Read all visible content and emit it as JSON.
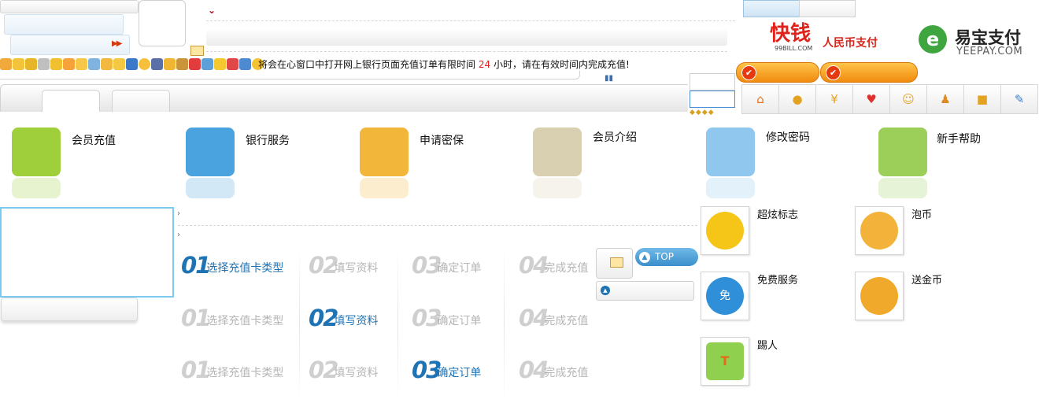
{
  "header": {
    "notice_prefix": "将会在心窗口中打开网上银行页面充值订单有限时间",
    "notice_hours": "24",
    "notice_suffix": "小时，请在有效时间内完成充值!",
    "rmb_pay": "人民币支付",
    "logo_99_big": "快钱",
    "logo_99_small": "99BILL.COM",
    "yeepay_title": "易宝支付",
    "yeepay_sub": "YEEPAY.COM",
    "yeepay_mark": "e"
  },
  "services": [
    {
      "label": "会员充值",
      "icon": "money-bags-icon",
      "color": "#9fcf3a"
    },
    {
      "label": "银行服务",
      "icon": "bank-card-icon",
      "color": "#4aa3df"
    },
    {
      "label": "申请密保",
      "icon": "safe-icon",
      "color": "#f2b63a"
    },
    {
      "label": "会员介绍",
      "icon": "coins-icon",
      "color": "#c9c9c9"
    },
    {
      "label": "修改密码",
      "icon": "padlock-icon",
      "color": "#8fc7ef"
    },
    {
      "label": "新手帮助",
      "icon": "help-lifebuoy-icon",
      "color": "#9ccf5a"
    }
  ],
  "steps": {
    "labels": [
      "选择充值卡类型",
      "填写资料",
      "确定订单",
      "完成充值"
    ],
    "numbers": [
      "01",
      "02",
      "03",
      "04"
    ]
  },
  "top_button": "TOP",
  "extra_services": [
    {
      "label": "超炫标志",
      "icon": "badge-icon",
      "color": "#f5c518"
    },
    {
      "label": "泡币",
      "icon": "coin-bowl-icon",
      "color": "#f3b33a"
    },
    {
      "label": "免费服务",
      "icon": "free-person-icon",
      "color": "#2f8fd8",
      "mark": "免"
    },
    {
      "label": "送金币",
      "icon": "gold-coins-icon",
      "color": "#f0a92b"
    },
    {
      "label": "踢人",
      "icon": "tshirt-icon",
      "color": "#8fd14f",
      "mark": "T"
    }
  ],
  "right_toolbar": [
    "home-icon",
    "money-bag-icon",
    "yuan-icon",
    "heart-icon",
    "smile-icon",
    "user-key-icon",
    "lock-icon",
    "pencil-icon"
  ]
}
